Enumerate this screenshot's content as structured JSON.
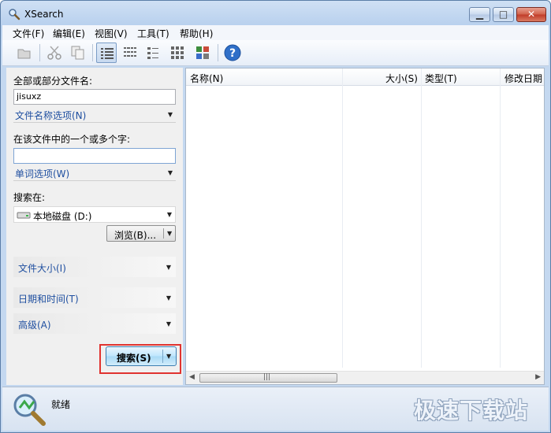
{
  "window": {
    "title": "XSearch"
  },
  "menu": [
    "文件(F)",
    "编辑(E)",
    "视图(V)",
    "工具(T)",
    "帮助(H)"
  ],
  "toolbar": {
    "icons": [
      "open-icon",
      "cut-icon",
      "copy-icon",
      "details-view-icon",
      "list-view-icon",
      "small-icons-view-icon",
      "large-icons-view-icon",
      "thumbnails-view-icon",
      "help-icon"
    ],
    "active": "details-view-icon"
  },
  "left": {
    "filename_label": "全部或部分文件名:",
    "filename_value": "jisuxz",
    "filename_options": "文件名称选项(N)",
    "words_label": "在该文件中的一个或多个字:",
    "words_value": "",
    "word_options": "单词选项(W)",
    "search_in_label": "搜索在:",
    "drive": "本地磁盘 (D:)",
    "browse": "浏览(B)...",
    "file_size": "文件大小(I)",
    "date_time": "日期和时间(T)",
    "advanced": "高级(A)",
    "search": "搜索(S)"
  },
  "results": {
    "columns": [
      "名称(N)",
      "大小(S)",
      "类型(T)",
      "修改日期"
    ]
  },
  "status": {
    "text": "就绪"
  },
  "watermark": "极速下载站",
  "colors": {
    "highlight": "#e0332f",
    "option_link": "#1f4fa0"
  }
}
